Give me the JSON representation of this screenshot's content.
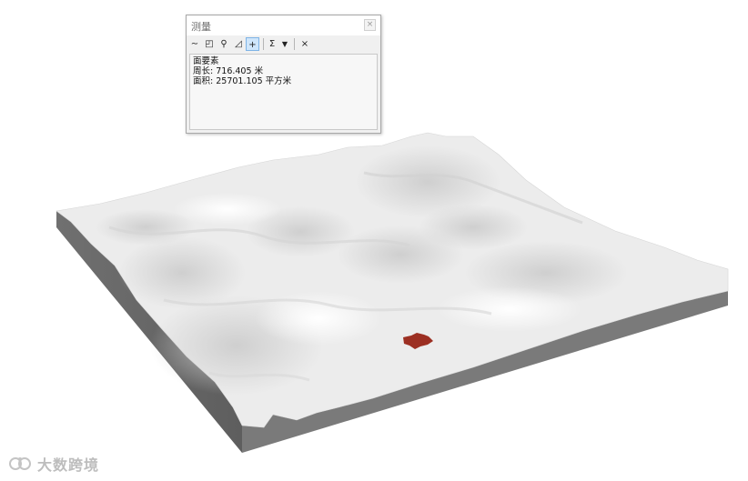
{
  "measure_window": {
    "title": "测量",
    "close_icon": "close-icon",
    "toolbar": {
      "items": [
        {
          "icon": "measure-line-icon",
          "glyph": "∼"
        },
        {
          "icon": "measure-area-icon",
          "glyph": "◰"
        },
        {
          "icon": "measure-feature-icon",
          "glyph": "⚲"
        },
        {
          "icon": "measure-polygon-icon",
          "glyph": "◿"
        },
        {
          "icon": "show-total-icon",
          "glyph": "+",
          "active": true
        },
        {
          "icon": "sum-icon",
          "glyph": "Σ"
        },
        {
          "icon": "dropdown-icon",
          "glyph": "▼"
        },
        {
          "icon": "clear-icon",
          "glyph": "×"
        }
      ]
    },
    "results": {
      "feature_type": "面要素",
      "perimeter_label": "周长:",
      "perimeter_value": "716.405",
      "perimeter_unit": "米",
      "area_label": "面积:",
      "area_value": "25701.105",
      "area_unit": "平方米"
    }
  },
  "terrain": {
    "highlight_color": "#9c2f22",
    "surface_color": "#e9e9e9",
    "side_color": "#6b6b6b"
  },
  "watermark": {
    "text": "大数跨境",
    "icon": "brand-logo-icon"
  }
}
